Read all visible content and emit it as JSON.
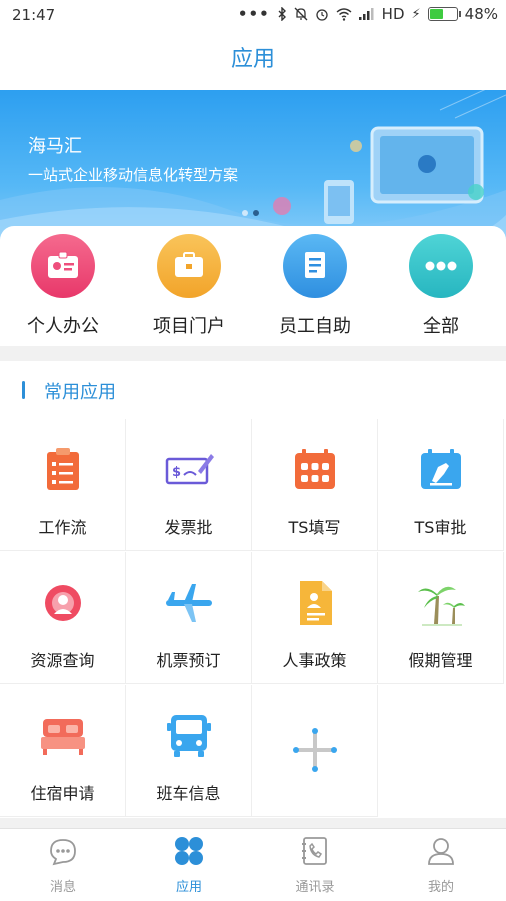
{
  "status": {
    "time": "21:47",
    "network": "HD",
    "battery": "48%",
    "battery_level": 0.48
  },
  "header": {
    "title": "应用"
  },
  "banner": {
    "title": "海马汇",
    "subtitle": "一站式企业移动信息化转型方案"
  },
  "shortcuts": [
    {
      "label": "个人办公",
      "icon": "badge-icon",
      "color": "#f0457a"
    },
    {
      "label": "项目门户",
      "icon": "briefcase-icon",
      "color": "#f6b63a"
    },
    {
      "label": "员工自助",
      "icon": "document-icon",
      "color": "#3aa6ee"
    },
    {
      "label": "全部",
      "icon": "more-icon",
      "color": "#2fc5c9"
    }
  ],
  "section": {
    "title": "常用应用"
  },
  "apps": [
    {
      "label": "工作流",
      "icon": "checklist-icon"
    },
    {
      "label": "发票批",
      "icon": "invoice-icon"
    },
    {
      "label": "TS填写",
      "icon": "calendar-grid-icon"
    },
    {
      "label": "TS审批",
      "icon": "calendar-stamp-icon"
    },
    {
      "label": "资源查询",
      "icon": "resource-search-icon"
    },
    {
      "label": "机票预订",
      "icon": "airplane-icon"
    },
    {
      "label": "人事政策",
      "icon": "personnel-doc-icon"
    },
    {
      "label": "假期管理",
      "icon": "palm-tree-icon"
    },
    {
      "label": "住宿申请",
      "icon": "bed-icon"
    },
    {
      "label": "班车信息",
      "icon": "bus-icon"
    },
    {
      "label": "",
      "icon": "add-icon"
    }
  ],
  "tabs": [
    {
      "label": "消息",
      "icon": "message-icon"
    },
    {
      "label": "应用",
      "icon": "apps-icon",
      "active": true
    },
    {
      "label": "通讯录",
      "icon": "contacts-icon"
    },
    {
      "label": "我的",
      "icon": "profile-icon"
    }
  ]
}
